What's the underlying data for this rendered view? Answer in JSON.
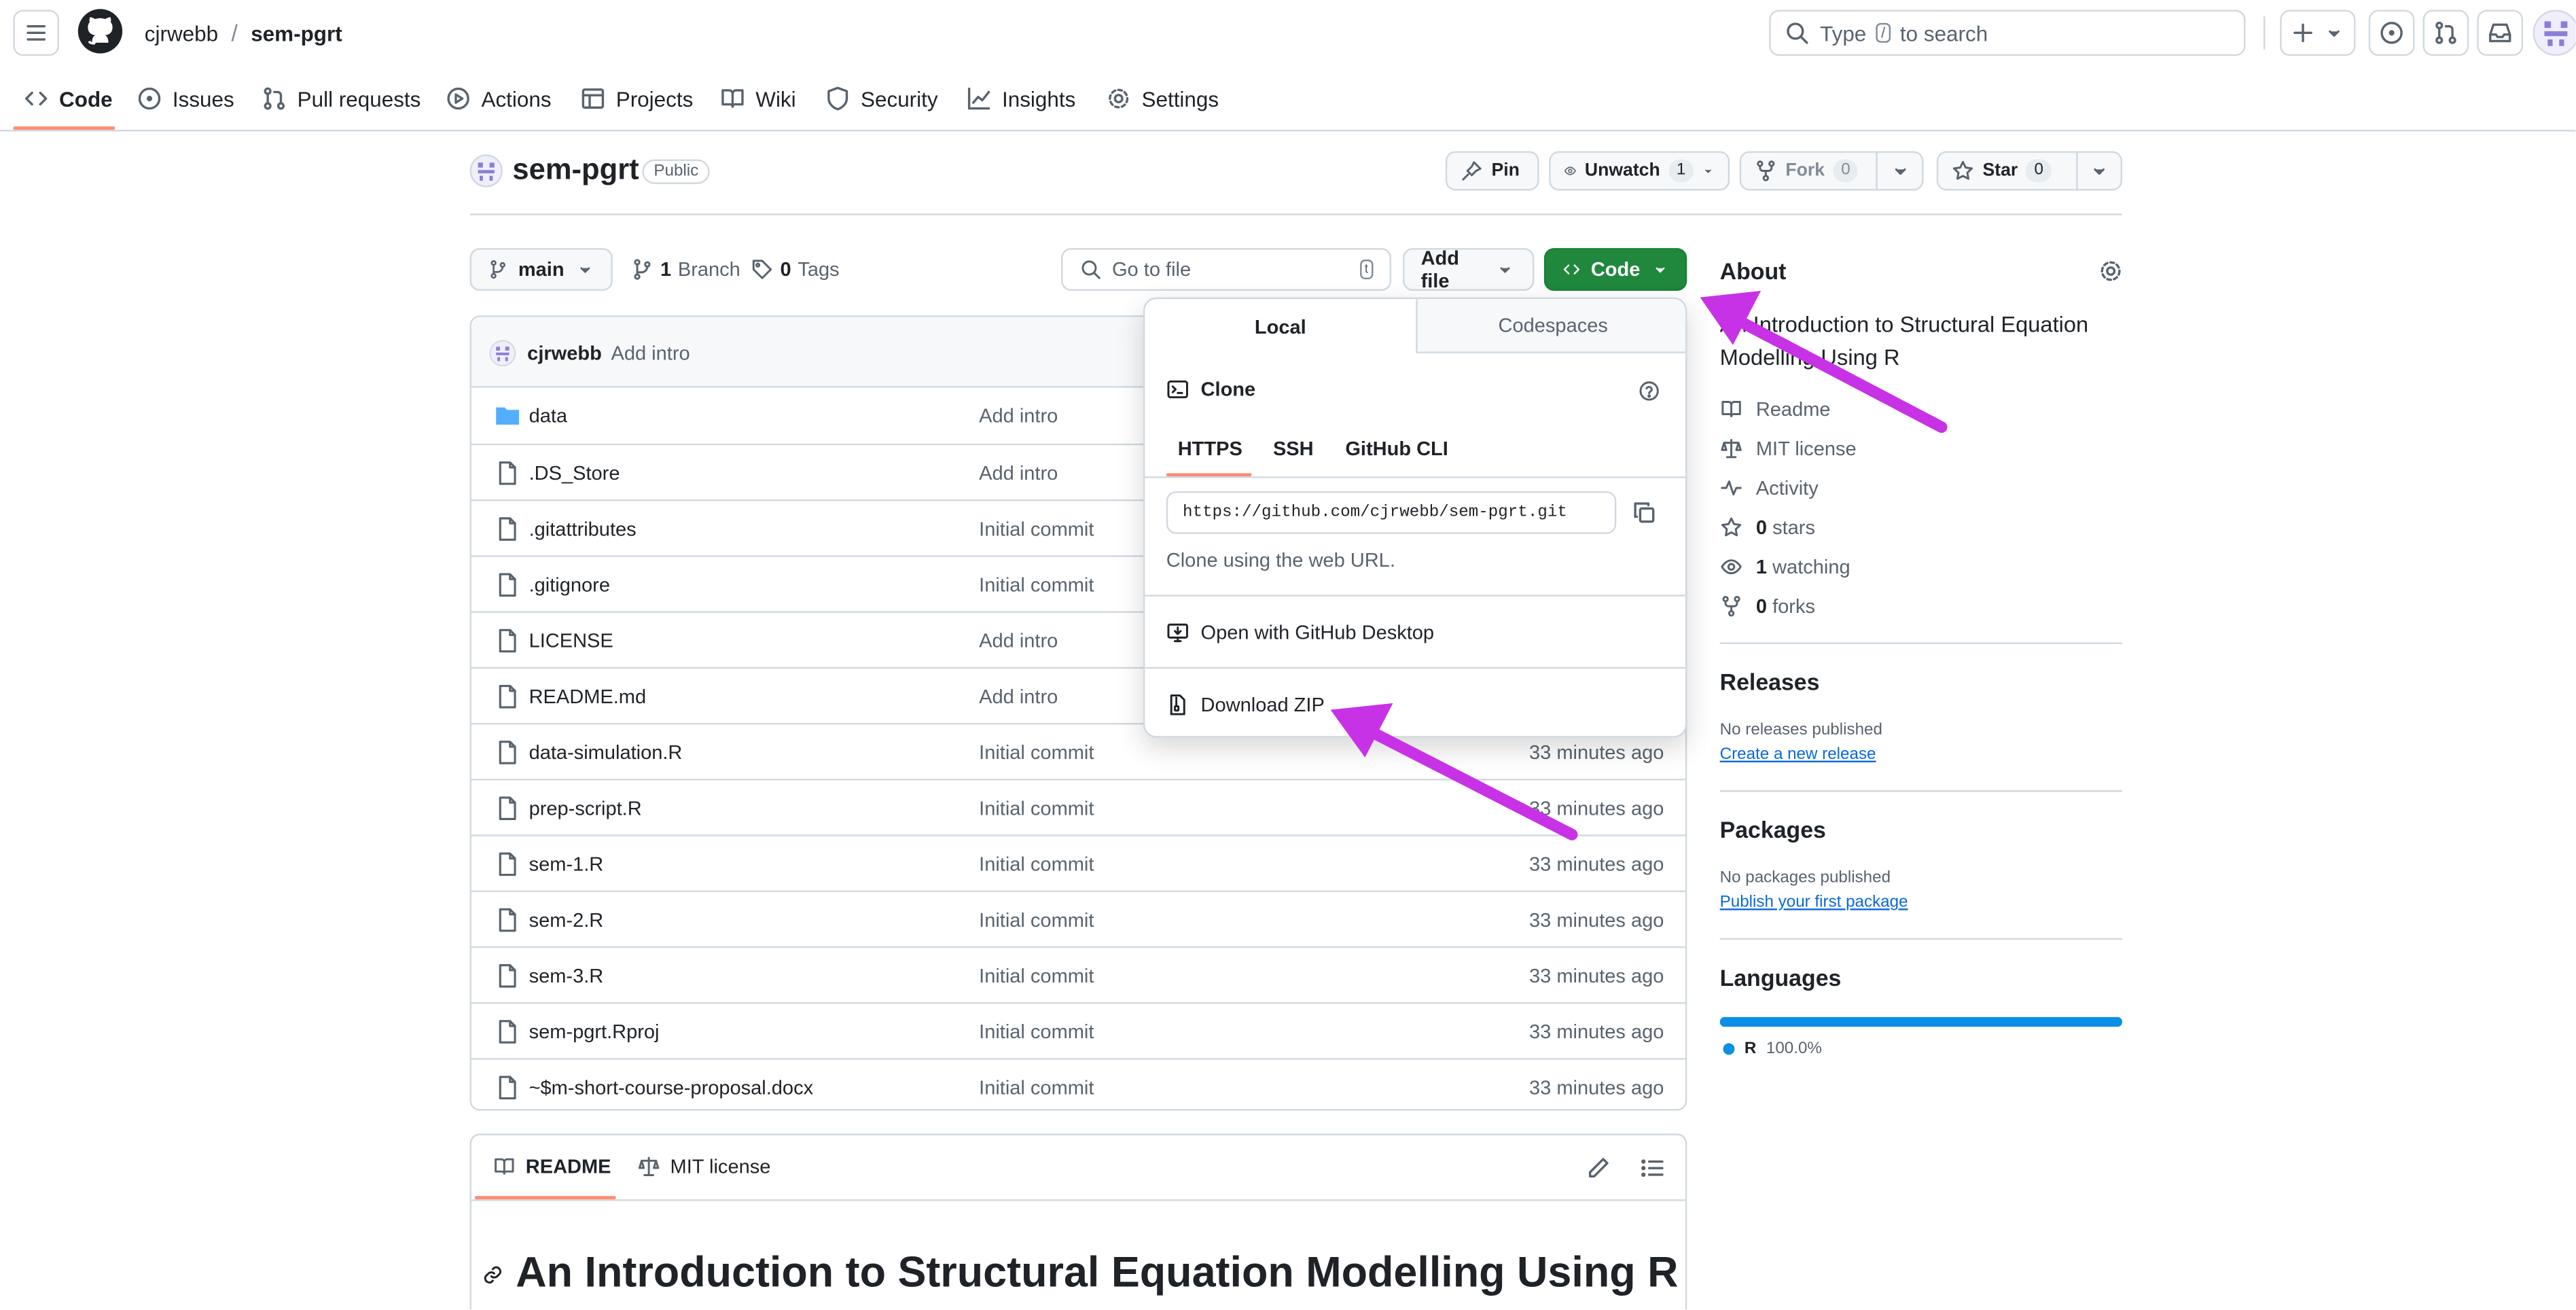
{
  "header": {
    "owner": "cjrwebb",
    "separator": "/",
    "repo": "sem-pgrt",
    "search_prefix": "Type",
    "search_key": "/",
    "search_suffix": "to search"
  },
  "nav": [
    {
      "label": "Code",
      "icon": "code-icon"
    },
    {
      "label": "Issues",
      "icon": "issue-icon"
    },
    {
      "label": "Pull requests",
      "icon": "pull-request-icon"
    },
    {
      "label": "Actions",
      "icon": "play-icon"
    },
    {
      "label": "Projects",
      "icon": "table-icon"
    },
    {
      "label": "Wiki",
      "icon": "book-icon"
    },
    {
      "label": "Security",
      "icon": "shield-icon"
    },
    {
      "label": "Insights",
      "icon": "graph-icon"
    },
    {
      "label": "Settings",
      "icon": "gear-icon"
    }
  ],
  "repo_header": {
    "title": "sem-pgrt",
    "visibility": "Public",
    "pin": "Pin",
    "unwatch": "Unwatch",
    "unwatch_count": "1",
    "fork": "Fork",
    "fork_count": "0",
    "star": "Star",
    "star_count": "0"
  },
  "toolbar": {
    "branch": "main",
    "branch_count": "1",
    "branch_label": "Branch",
    "tag_count": "0",
    "tag_label": "Tags",
    "go_to_file": "Go to file",
    "go_to_file_key": "t",
    "add_file": "Add file",
    "code": "Code"
  },
  "latest_commit": {
    "author": "cjrwebb",
    "message": "Add intro"
  },
  "files": [
    {
      "name": "data",
      "type": "folder",
      "message": "Add intro",
      "age": ""
    },
    {
      "name": ".DS_Store",
      "type": "file",
      "message": "Add intro",
      "age": ""
    },
    {
      "name": ".gitattributes",
      "type": "file",
      "message": "Initial commit",
      "age": ""
    },
    {
      "name": ".gitignore",
      "type": "file",
      "message": "Initial commit",
      "age": ""
    },
    {
      "name": "LICENSE",
      "type": "file",
      "message": "Add intro",
      "age": ""
    },
    {
      "name": "README.md",
      "type": "file",
      "message": "Add intro",
      "age": ""
    },
    {
      "name": "data-simulation.R",
      "type": "file",
      "message": "Initial commit",
      "age": "33 minutes ago"
    },
    {
      "name": "prep-script.R",
      "type": "file",
      "message": "Initial commit",
      "age": "33 minutes ago"
    },
    {
      "name": "sem-1.R",
      "type": "file",
      "message": "Initial commit",
      "age": "33 minutes ago"
    },
    {
      "name": "sem-2.R",
      "type": "file",
      "message": "Initial commit",
      "age": "33 minutes ago"
    },
    {
      "name": "sem-3.R",
      "type": "file",
      "message": "Initial commit",
      "age": "33 minutes ago"
    },
    {
      "name": "sem-pgrt.Rproj",
      "type": "file",
      "message": "Initial commit",
      "age": "33 minutes ago"
    },
    {
      "name": "~$m-short-course-proposal.docx",
      "type": "file",
      "message": "Initial commit",
      "age": "33 minutes ago"
    }
  ],
  "popover": {
    "tab_local": "Local",
    "tab_codespaces": "Codespaces",
    "clone_label": "Clone",
    "https": "HTTPS",
    "ssh": "SSH",
    "cli": "GitHub CLI",
    "url": "https://github.com/cjrwebb/sem-pgrt.git",
    "hint": "Clone using the web URL.",
    "open_desktop": "Open with GitHub Desktop",
    "download_zip": "Download ZIP"
  },
  "readme": {
    "tab_readme": "README",
    "tab_license": "MIT license",
    "heading": "An Introduction to Structural Equation Modelling Using R"
  },
  "sidebar": {
    "about_title": "About",
    "description": "An Introduction to Structural Equation Modelling Using R",
    "readme": "Readme",
    "license": "MIT license",
    "activity": "Activity",
    "stars_count": "0",
    "stars_label": "stars",
    "watching_count": "1",
    "watching_label": "watching",
    "forks_count": "0",
    "forks_label": "forks",
    "releases_title": "Releases",
    "no_releases": "No releases published",
    "create_release": "Create a new release",
    "packages_title": "Packages",
    "no_packages": "No packages published",
    "publish_package": "Publish your first package",
    "languages_title": "Languages",
    "lang_name": "R",
    "lang_percent": "100.0%",
    "lang_fraction": 1.0
  },
  "colors": {
    "accent_green": "#1f883d",
    "arrow_magenta": "#c832e6",
    "link_blue": "#0969da",
    "lang_blue": "#0a8fe8",
    "nav_underline": "#fd8c73"
  }
}
